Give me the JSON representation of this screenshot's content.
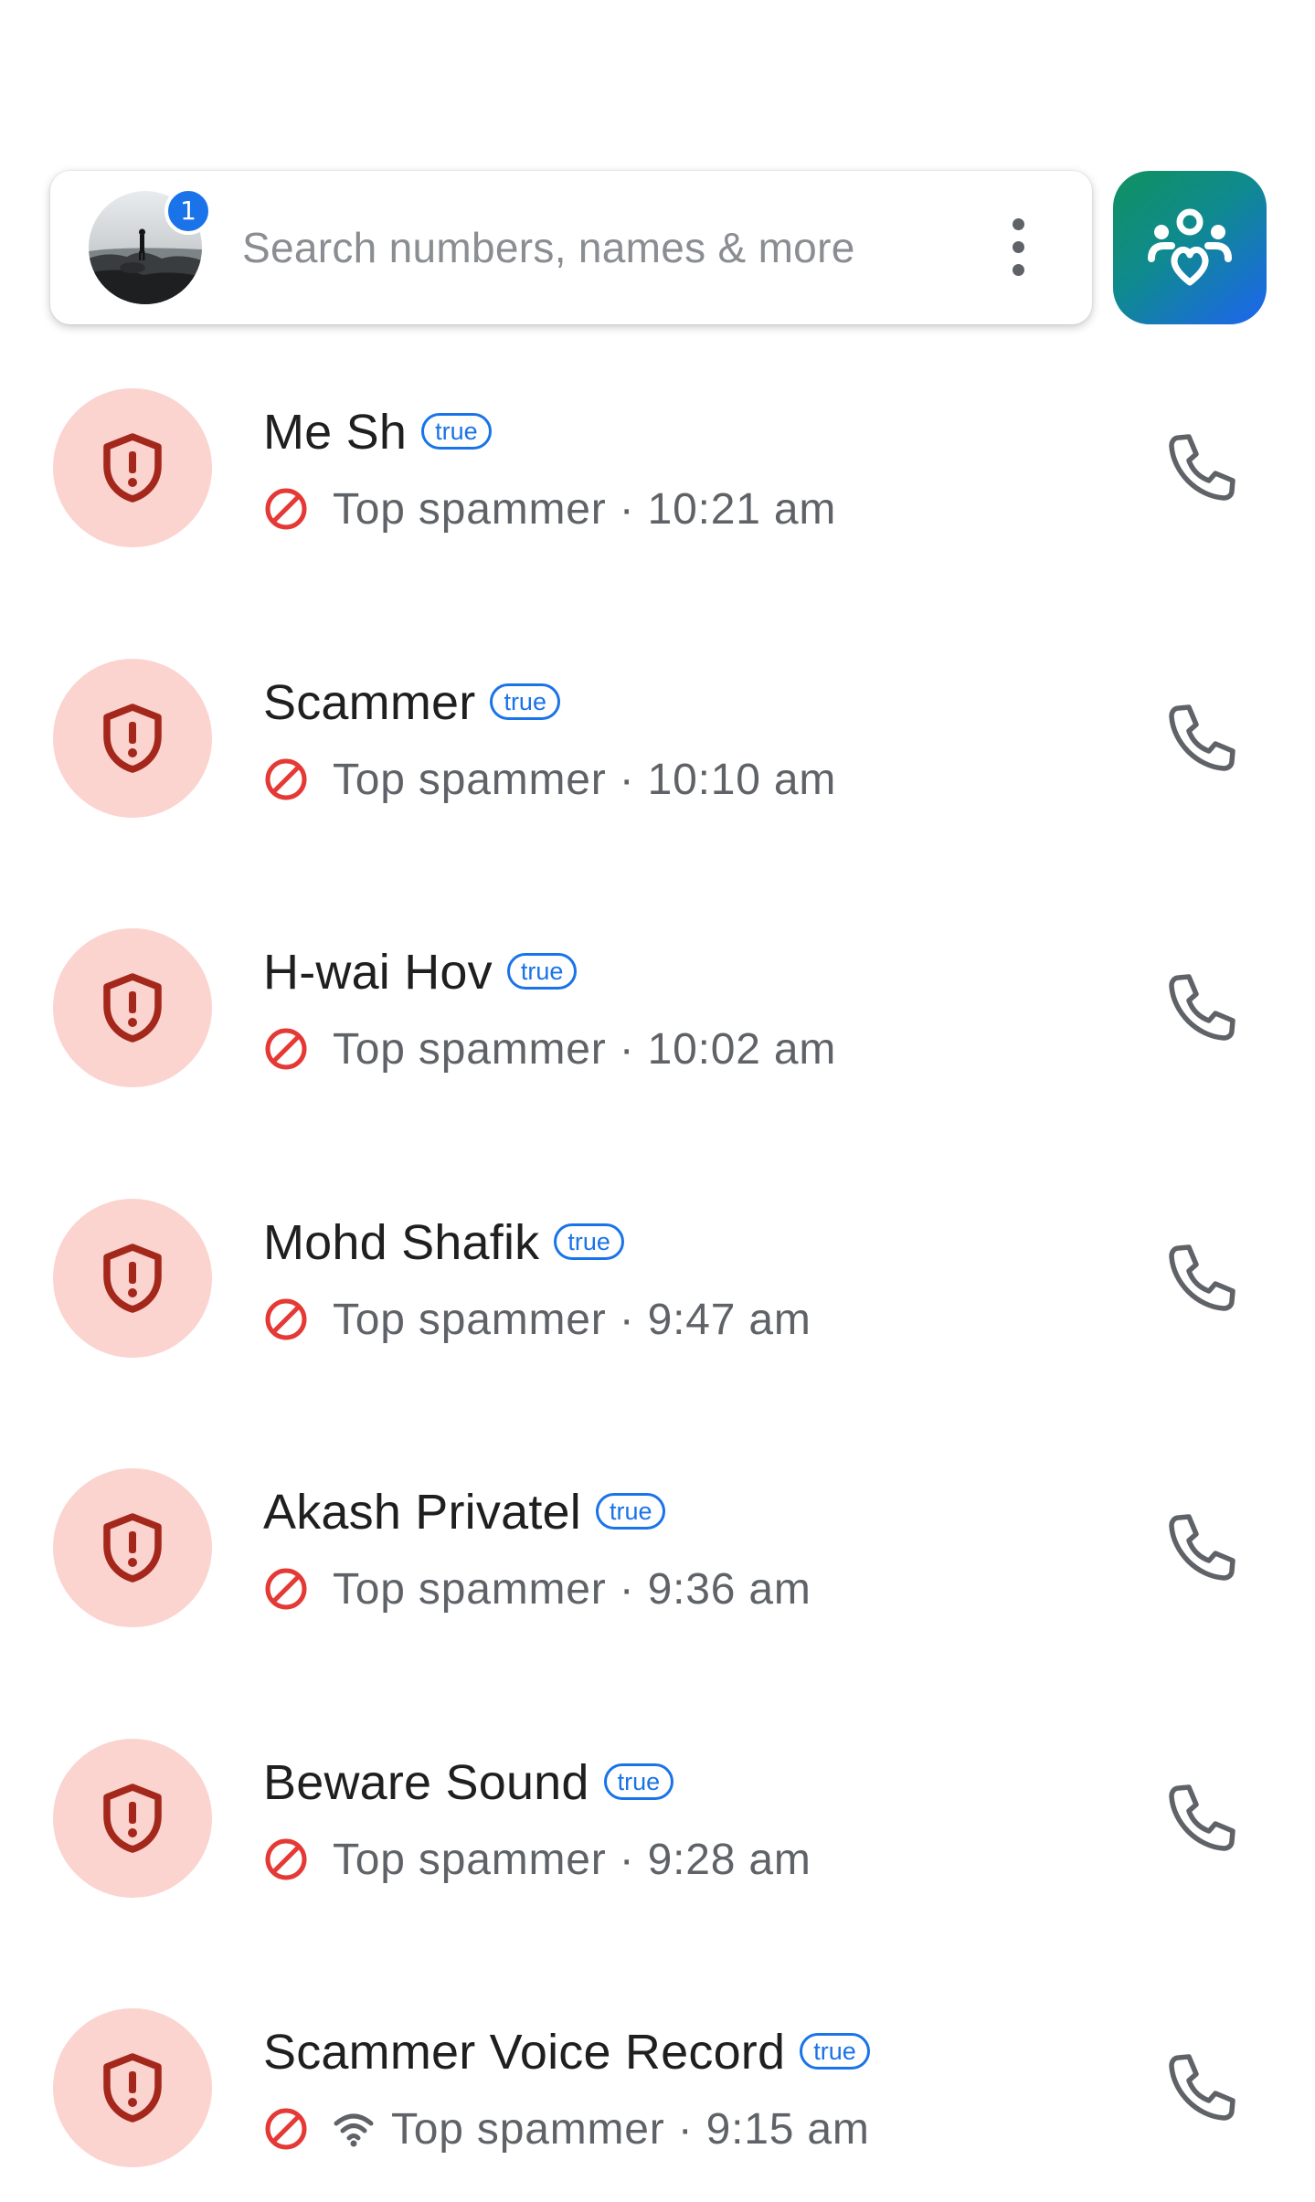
{
  "search": {
    "avatar_badge_count": "1",
    "placeholder": "Search numbers, names & more"
  },
  "calls": [
    {
      "name": "Me Sh",
      "badge": "true",
      "status": "Top spammer",
      "time": "10:21 am",
      "wifi": false
    },
    {
      "name": "Scammer",
      "badge": "true",
      "status": "Top spammer",
      "time": "10:10 am",
      "wifi": false
    },
    {
      "name": "H-wai Hov",
      "badge": "true",
      "status": "Top spammer",
      "time": "10:02 am",
      "wifi": false
    },
    {
      "name": "Mohd Shafik",
      "badge": "true",
      "status": "Top spammer",
      "time": "9:47 am",
      "wifi": false
    },
    {
      "name": "Akash Privatel",
      "badge": "true",
      "status": "Top spammer",
      "time": "9:36 am",
      "wifi": false
    },
    {
      "name": "Beware Sound",
      "badge": "true",
      "status": "Top spammer",
      "time": "9:28 am",
      "wifi": false
    },
    {
      "name": "Scammer Voice Record",
      "badge": "true",
      "status": "Top spammer",
      "time": "9:15 am",
      "wifi": true
    }
  ],
  "icons": {
    "row_avatar": "shield-alert-icon",
    "status": "block-icon",
    "call": "phone-icon",
    "more": "more-vert-icon",
    "community": "community-icon",
    "wifi": "wifi-icon"
  },
  "colors": {
    "spam_bg": "#fbd3cf",
    "spam_icon": "#a3271b",
    "block_red": "#e53935",
    "badge_blue": "#1a73e8"
  }
}
